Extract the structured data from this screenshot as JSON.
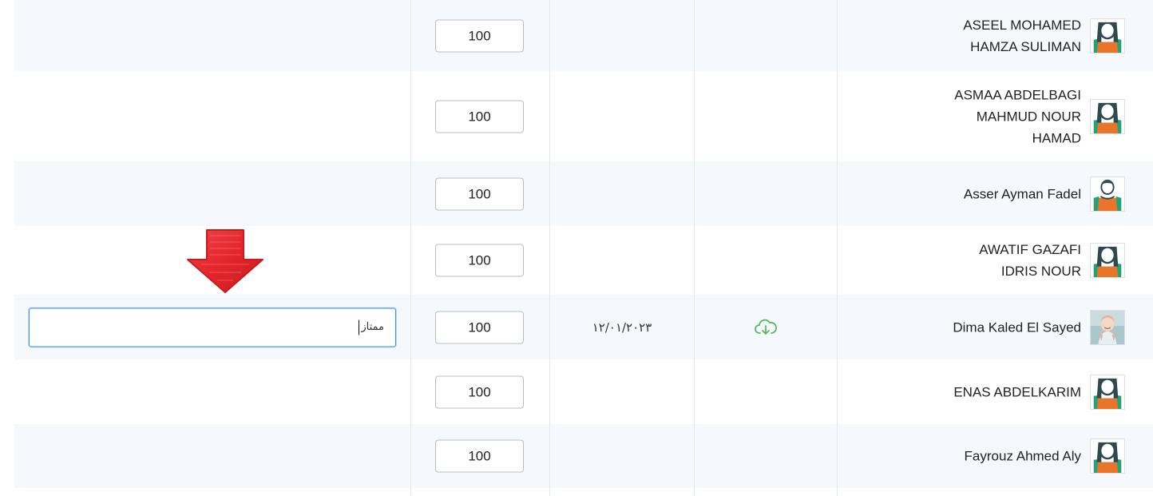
{
  "rows": [
    {
      "name": "ASEEL MOHAMED\nHAMZA SULIMAN",
      "grade": "100",
      "date": "",
      "note": "",
      "avatar": "female-placeholder-icon",
      "has_file": false
    },
    {
      "name": "ASMAA ABDELBAGI\nMAHMUD NOUR\nHAMAD",
      "grade": "100",
      "date": "",
      "note": "",
      "avatar": "female-placeholder-icon",
      "has_file": false
    },
    {
      "name": "Asser Ayman Fadel",
      "grade": "100",
      "date": "",
      "note": "",
      "avatar": "male-placeholder-icon",
      "has_file": false
    },
    {
      "name": "AWATIF GAZAFI\nIDRIS NOUR",
      "grade": "100",
      "date": "",
      "note": "",
      "avatar": "female-placeholder-icon",
      "has_file": false
    },
    {
      "name": "Dima Kaled El Sayed",
      "grade": "100",
      "date": "١٢/٠١/٢٠٢٣",
      "note": "ممتاز",
      "avatar": "student-photo",
      "has_file": true
    },
    {
      "name": "ENAS ABDELKARIM",
      "grade": "100",
      "date": "",
      "note": "",
      "avatar": "female-placeholder-icon",
      "has_file": false
    },
    {
      "name": "Fayrouz Ahmed Aly",
      "grade": "100",
      "date": "",
      "note": "",
      "avatar": "female-placeholder-icon",
      "has_file": false
    }
  ],
  "colors": {
    "stripe": "#f5f9fd",
    "focus_border": "#3d8fe0",
    "download_icon": "#5cb85c",
    "arrow": "#e3262b",
    "avatar_bg": "#2e4a4f",
    "avatar_accent": "#e8752a",
    "avatar_green": "#1fa37a"
  },
  "icons": {
    "download": "cloud-download-icon",
    "pointer": "red-down-arrow"
  }
}
